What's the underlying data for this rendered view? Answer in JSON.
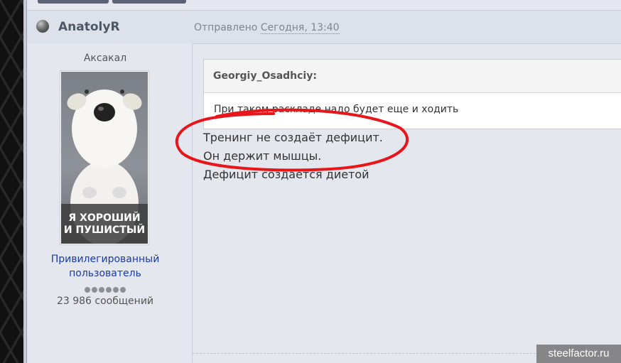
{
  "post": {
    "author": "AnatolyR",
    "posted_prefix": "Отправлено",
    "posted_date": "Сегодня, 13:40"
  },
  "user": {
    "rank_title": "Аксакал",
    "avatar_caption_line1": "Я ХОРОШИЙ",
    "avatar_caption_line2": "И ПУШИСТЫЙ",
    "group_line1": "Привилегированный",
    "group_line2": "пользователь",
    "rank_pips": 6,
    "post_count": "23 986 сообщений"
  },
  "quote": {
    "author": "Georgiy_Osadhciy:",
    "text": "При таком раскладе надо будет еще и ходить"
  },
  "body": {
    "line1": "Тренинг не создаёт дефицит.",
    "line2": "Он держит мышцы.",
    "line3": "Дефицит создается диетой"
  },
  "annotation": {
    "color": "#e8151b"
  },
  "watermark": "steelfactor.ru",
  "colors": {
    "group_link": "#1a3aa8",
    "header_bg": "#dde2ea",
    "page_bg": "#e4e7ee"
  }
}
